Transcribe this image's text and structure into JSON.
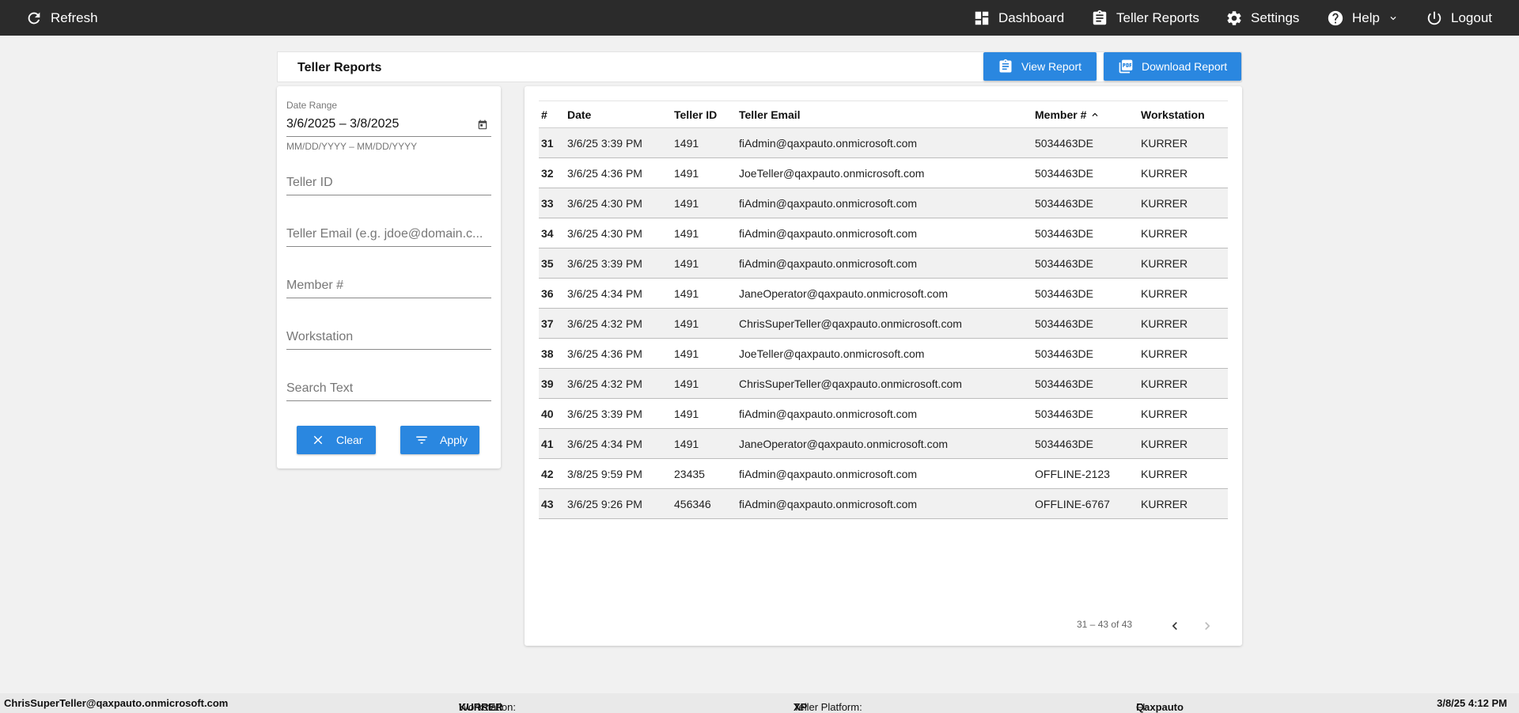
{
  "topbar": {
    "refresh_label": "Refresh",
    "nav": {
      "dashboard": "Dashboard",
      "teller_reports": "Teller Reports",
      "settings": "Settings",
      "help": "Help",
      "logout": "Logout"
    }
  },
  "header": {
    "title": "Teller Reports",
    "view_report": "View Report",
    "download_report": "Download Report"
  },
  "filters": {
    "date_range_label": "Date Range",
    "date_range_value": "3/6/2025 – 3/8/2025",
    "date_hint": "MM/DD/YYYY – MM/DD/YYYY",
    "teller_id_placeholder": "Teller ID",
    "teller_email_placeholder": "Teller Email (e.g. jdoe@domain.c...",
    "member_placeholder": "Member #",
    "workstation_placeholder": "Workstation",
    "search_placeholder": "Search Text",
    "clear_label": "Clear",
    "apply_label": "Apply"
  },
  "table": {
    "columns": [
      "#",
      "Date",
      "Teller ID",
      "Teller Email",
      "Member #",
      "Workstation"
    ],
    "sorted_column": "Member #",
    "sort_direction": "ascending",
    "rows": [
      [
        "31",
        "3/6/25 3:39 PM",
        "1491",
        "fiAdmin@qaxpauto.onmicrosoft.com",
        "5034463DE",
        "KURRER"
      ],
      [
        "32",
        "3/6/25 4:36 PM",
        "1491",
        "JoeTeller@qaxpauto.onmicrosoft.com",
        "5034463DE",
        "KURRER"
      ],
      [
        "33",
        "3/6/25 4:30 PM",
        "1491",
        "fiAdmin@qaxpauto.onmicrosoft.com",
        "5034463DE",
        "KURRER"
      ],
      [
        "34",
        "3/6/25 4:30 PM",
        "1491",
        "fiAdmin@qaxpauto.onmicrosoft.com",
        "5034463DE",
        "KURRER"
      ],
      [
        "35",
        "3/6/25 3:39 PM",
        "1491",
        "fiAdmin@qaxpauto.onmicrosoft.com",
        "5034463DE",
        "KURRER"
      ],
      [
        "36",
        "3/6/25 4:34 PM",
        "1491",
        "JaneOperator@qaxpauto.onmicrosoft.com",
        "5034463DE",
        "KURRER"
      ],
      [
        "37",
        "3/6/25 4:32 PM",
        "1491",
        "ChrisSuperTeller@qaxpauto.onmicrosoft.com",
        "5034463DE",
        "KURRER"
      ],
      [
        "38",
        "3/6/25 4:36 PM",
        "1491",
        "JoeTeller@qaxpauto.onmicrosoft.com",
        "5034463DE",
        "KURRER"
      ],
      [
        "39",
        "3/6/25 4:32 PM",
        "1491",
        "ChrisSuperTeller@qaxpauto.onmicrosoft.com",
        "5034463DE",
        "KURRER"
      ],
      [
        "40",
        "3/6/25 3:39 PM",
        "1491",
        "fiAdmin@qaxpauto.onmicrosoft.com",
        "5034463DE",
        "KURRER"
      ],
      [
        "41",
        "3/6/25 4:34 PM",
        "1491",
        "JaneOperator@qaxpauto.onmicrosoft.com",
        "5034463DE",
        "KURRER"
      ],
      [
        "42",
        "3/8/25 9:59 PM",
        "23435",
        "fiAdmin@qaxpauto.onmicrosoft.com",
        "OFFLINE-2123",
        "KURRER"
      ],
      [
        "43",
        "3/6/25 9:26 PM",
        "456346",
        "fiAdmin@qaxpauto.onmicrosoft.com",
        "OFFLINE-6767",
        "KURRER"
      ]
    ]
  },
  "pager": {
    "range_text": "31 – 43 of 43"
  },
  "footer": {
    "user": "ChrisSuperTeller@qaxpauto.onmicrosoft.com",
    "workstation_label": "Workstation:",
    "workstation_value": "KURRER",
    "platform_label": "Teller Platform:",
    "platform_value": "XP",
    "fi_label": "FI:",
    "fi_value": "Qaxpauto",
    "timestamp": "3/8/25 4:12 PM"
  },
  "colors": {
    "topbar_bg": "#2b2b2b",
    "accent_blue": "#2a87e0",
    "page_bg": "#f1f1f1"
  }
}
